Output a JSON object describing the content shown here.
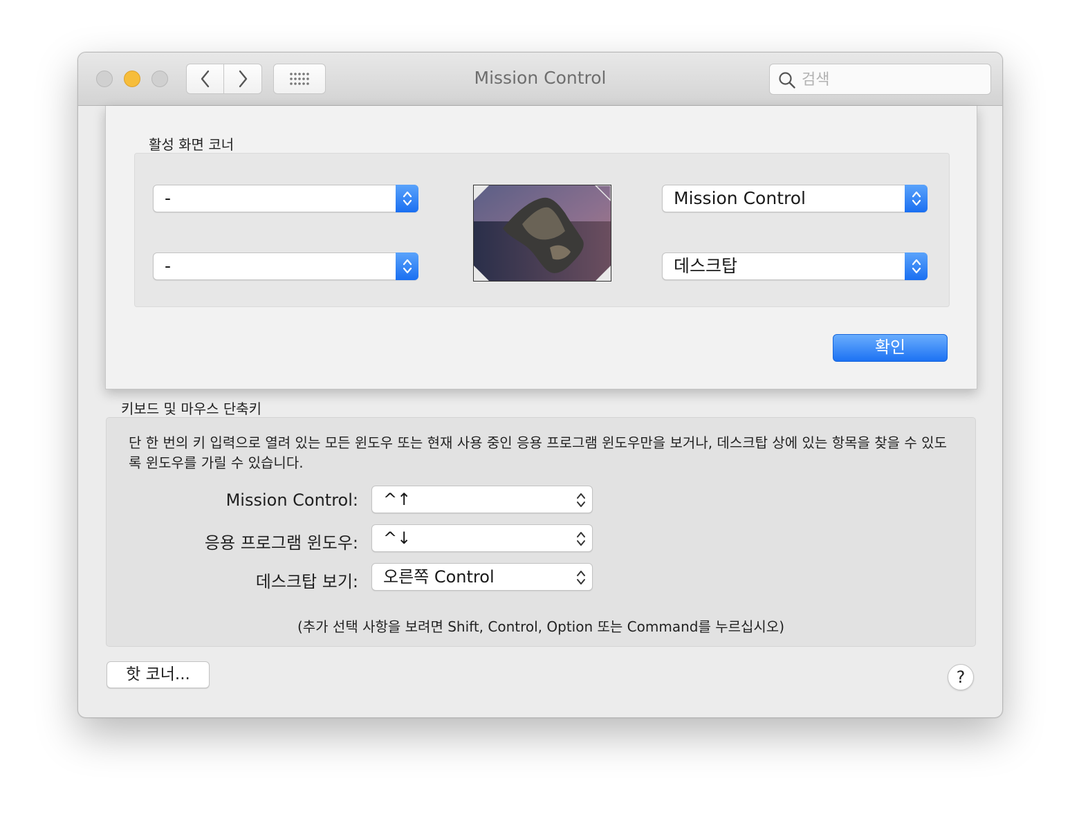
{
  "window": {
    "title": "Mission Control"
  },
  "toolbar": {
    "back_icon": "chevron-left-icon",
    "forward_icon": "chevron-right-icon",
    "grid_icon": "show-all-grid-icon"
  },
  "search": {
    "placeholder": "검색",
    "value": "",
    "icon": "magnifier-icon"
  },
  "sheet": {
    "title": "활성 화면 코너",
    "corners": {
      "top_left": "-",
      "bottom_left": "-",
      "top_right": "Mission Control",
      "bottom_right": "데스크탑"
    },
    "ok_label": "확인"
  },
  "keyboard": {
    "title": "키보드 및 마우스 단축키",
    "description": "단 한 번의 키 입력으로 열려 있는 모든 윈도우 또는 현재 사용 중인 응용 프로그램 윈도우만을 보거나, 데스크탑 상에 있는 항목을 찾을 수 있도록 윈도우를 가릴 수 있습니다.",
    "rows": [
      {
        "label": "Mission Control:",
        "value": "^↑"
      },
      {
        "label": "응용 프로그램 윈도우:",
        "value": "^↓"
      },
      {
        "label": "데스크탑 보기:",
        "value": "오른쪽 Control"
      }
    ],
    "note": "(추가 선택 사항을 보려면 Shift, Control, Option 또는 Command를 누르십시오)"
  },
  "footer": {
    "hot_corners_label": "핫 코너...",
    "help_label": "?"
  },
  "colors": {
    "accent": "#1d72f3",
    "minimize": "#f6bd3b"
  }
}
